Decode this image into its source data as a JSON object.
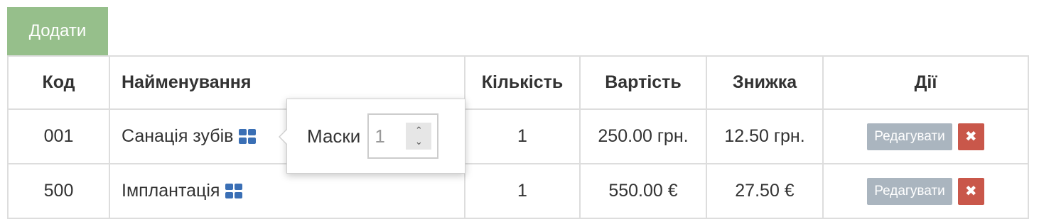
{
  "toolbar": {
    "add_label": "Додати"
  },
  "table": {
    "headers": {
      "code": "Код",
      "name": "Найменування",
      "qty": "Кількість",
      "price": "Вартість",
      "discount": "Знижка",
      "actions": "Дії"
    },
    "rows": [
      {
        "code": "001",
        "name": "Санація зубів",
        "qty": "1",
        "price": "250.00 грн.",
        "discount": "12.50 грн.",
        "edit": "Редагувати",
        "delete_icon": "close-icon"
      },
      {
        "code": "500",
        "name": "Імплантація",
        "qty": "1",
        "price": "550.00 €",
        "discount": "27.50 €",
        "edit": "Редагувати",
        "delete_icon": "close-icon"
      }
    ]
  },
  "popover": {
    "label": "Маски",
    "value": "1"
  },
  "colors": {
    "add_button": "#96bf8b",
    "edit_button": "#aab5bf",
    "delete_button": "#c9574a",
    "grid_icon": "#3a6fb5"
  }
}
